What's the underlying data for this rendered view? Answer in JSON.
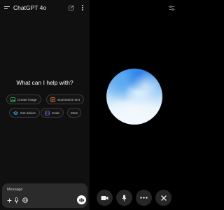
{
  "app": {
    "title": "ChatGPT 4o"
  },
  "home": {
    "headline": "What can I help with?"
  },
  "suggestions": [
    {
      "label": "Create image",
      "icon": "image-icon",
      "color": "#37c26b"
    },
    {
      "label": "Summarize text",
      "icon": "document-icon",
      "color": "#f08a3a"
    },
    {
      "label": "Get advice",
      "icon": "graduation-cap-icon",
      "color": "#35b7e6"
    },
    {
      "label": "Code",
      "icon": "code-icon",
      "color": "#8f7cf2"
    },
    {
      "label": "More",
      "icon": "",
      "color": "#c9c9c9"
    }
  ],
  "composer": {
    "placeholder": "Message",
    "actions": [
      "plus-icon",
      "microphone-icon",
      "globe-icon",
      "voice-mode-icon"
    ]
  },
  "voice": {
    "orb_colors": [
      "#2a7fe6",
      "#9fcef5",
      "#f6fafe"
    ],
    "controls": [
      "video-camera-icon",
      "microphone-icon",
      "more-icon",
      "close-icon"
    ]
  }
}
